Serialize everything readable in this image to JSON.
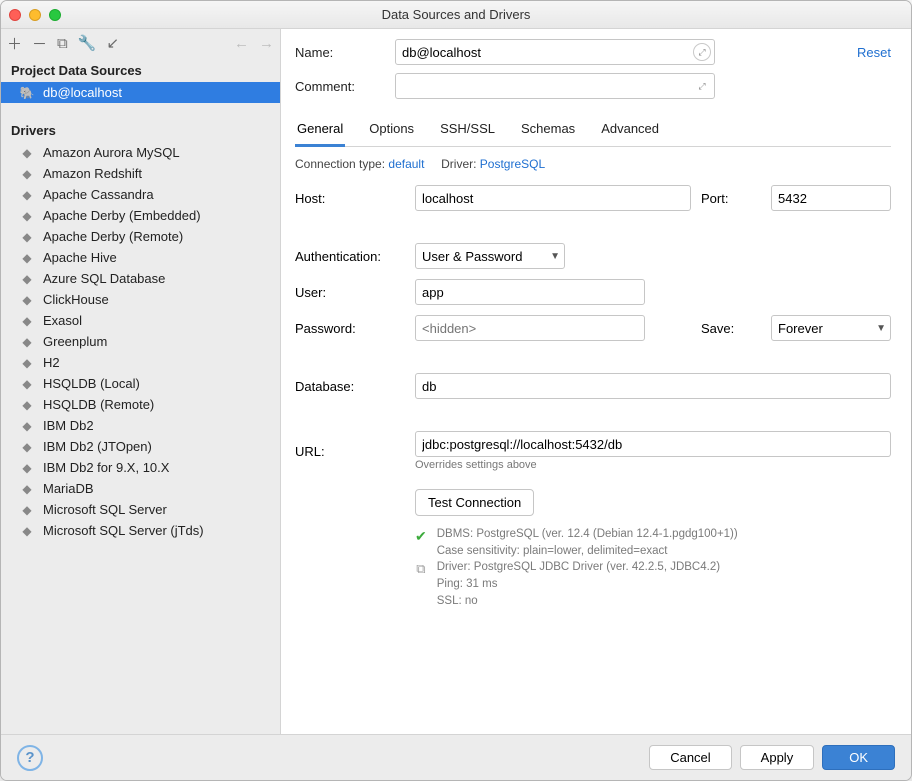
{
  "window": {
    "title": "Data Sources and Drivers"
  },
  "toolbar": {
    "reset": "Reset"
  },
  "sidebar": {
    "project_title": "Project Data Sources",
    "project_items": [
      {
        "label": "db@localhost",
        "selected": true
      }
    ],
    "drivers_title": "Drivers",
    "drivers": [
      "Amazon Aurora MySQL",
      "Amazon Redshift",
      "Apache Cassandra",
      "Apache Derby (Embedded)",
      "Apache Derby (Remote)",
      "Apache Hive",
      "Azure SQL Database",
      "ClickHouse",
      "Exasol",
      "Greenplum",
      "H2",
      "HSQLDB (Local)",
      "HSQLDB (Remote)",
      "IBM Db2",
      "IBM Db2 (JTOpen)",
      "IBM Db2 for 9.X, 10.X",
      "MariaDB",
      "Microsoft SQL Server",
      "Microsoft SQL Server (jTds)"
    ]
  },
  "form": {
    "name_label": "Name:",
    "name_value": "db@localhost",
    "comment_label": "Comment:",
    "comment_value": ""
  },
  "tabs": [
    "General",
    "Options",
    "SSH/SSL",
    "Schemas",
    "Advanced"
  ],
  "active_tab": "General",
  "conn": {
    "type_label": "Connection type:",
    "type_value": "default",
    "driver_label": "Driver:",
    "driver_value": "PostgreSQL"
  },
  "fields": {
    "host_label": "Host:",
    "host_value": "localhost",
    "port_label": "Port:",
    "port_value": "5432",
    "auth_label": "Authentication:",
    "auth_value": "User & Password",
    "user_label": "User:",
    "user_value": "app",
    "password_label": "Password:",
    "password_placeholder": "<hidden>",
    "save_label": "Save:",
    "save_value": "Forever",
    "database_label": "Database:",
    "database_value": "db",
    "url_label": "URL:",
    "url_value": "jdbc:postgresql://localhost:5432/db",
    "url_helper": "Overrides settings above",
    "test_button": "Test Connection"
  },
  "status": {
    "line1": "DBMS: PostgreSQL (ver. 12.4 (Debian 12.4-1.pgdg100+1))",
    "line2": "Case sensitivity: plain=lower, delimited=exact",
    "line3": "Driver: PostgreSQL JDBC Driver (ver. 42.2.5, JDBC4.2)",
    "line4": "Ping: 31 ms",
    "line5": "SSL: no"
  },
  "footer": {
    "cancel": "Cancel",
    "apply": "Apply",
    "ok": "OK"
  }
}
